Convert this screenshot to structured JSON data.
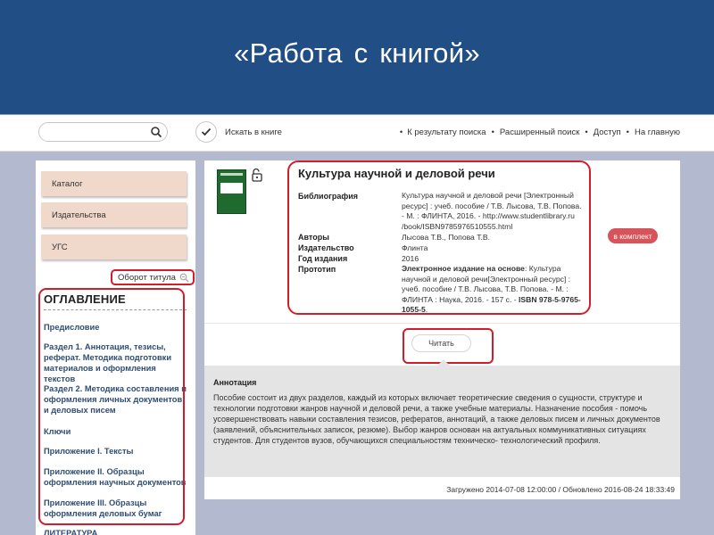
{
  "banner": {
    "title": "«Работа  с книгой»"
  },
  "topbar": {
    "search_value": "",
    "search_in_book_label": "Искать в книге",
    "nav": [
      "К результату поиска",
      "Расширенный поиск",
      "Доступ",
      "На главную"
    ]
  },
  "sidebar": {
    "buttons": [
      "Каталог",
      "Издательства",
      "УГС"
    ],
    "oborot_label": "Оборот титула",
    "toc_title": "ОГЛАВЛЕНИЕ",
    "toc_items": [
      "Предисловие",
      "Раздел 1. Аннотация, тезисы, реферат. Методика подготовки материалов и оформления текстов",
      "Раздел 2. Методика составления и оформления личных документов и деловых писем",
      "Ключи",
      "Приложение I. Тексты",
      "Приложение II. Образцы оформления научных документов",
      "Приложение III. Образцы оформления деловых бумаг",
      "ЛИТЕРАТУРА"
    ]
  },
  "book": {
    "title": "Культура научной и деловой речи",
    "labels": {
      "bibliography": "Библиография",
      "authors": "Авторы",
      "publisher": "Издательство",
      "year": "Год издания",
      "prototype": "Прототип"
    },
    "bibliography": "Культура научной и деловой речи [Электронный ресурс] : учеб. пособие / Т.В. Лысова, Т.В. Попова. - М. : ФЛИНТА, 2016. - http://www.studentlibrary.ru /book/ISBN9785976510555.html",
    "authors": "Лысова Т.В., Попова Т.В.",
    "publisher": "Флинта",
    "year": "2016",
    "prototype_bold": "Электронное издание на основе",
    "prototype_rest": ": Культура научной и деловой речи[Электронный ресурс] : учеб. пособие / Т.В. Лысова, Т.В. Попова. - М. : ФЛИНТА : Наука, 2016. - 157 с. - ",
    "prototype_isbn": "ISBN 978-5-9765-1055-5",
    "prototype_end": ".",
    "komplekt_label": "в комплект",
    "read_label": "Читать"
  },
  "annotation": {
    "title": "Аннотация",
    "text": "Пособие состоит из двух разделов, каждый из которых включает теоретические сведения о сущности, структуре и технологии подготовки жанров научной и деловой речи, а также учебные материалы. Назначение пособия - помочь усовершенствовать навыки составления тезисов, рефератов, аннотаций, а также деловых писем и личных документов (заявлений, объяснительных записок, резюме). Выбор жанров основан на актуальных коммуникативных ситуациях студентов. Для студентов вузов, обучающихся специальностям техническо- технологический профиля."
  },
  "footer": {
    "uploaded": "Загружено 2014-07-08 12:00:00 / Обновлено 2016-08-24 18:33:49"
  },
  "colors": {
    "banner": "#214e85",
    "highlight": "#d21e2a",
    "side_button": "#f0d8cb",
    "komplekt": "#d6545a"
  }
}
